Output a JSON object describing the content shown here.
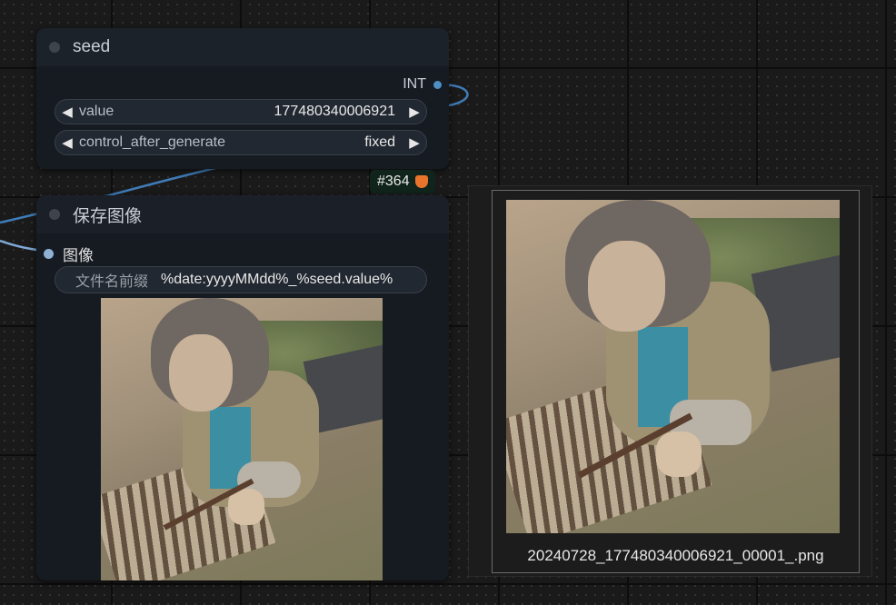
{
  "seed_node": {
    "title": "seed",
    "output_label": "INT",
    "widgets": [
      {
        "label": "value",
        "value": "177480340006921"
      },
      {
        "label": "control_after_generate",
        "value": "fixed"
      }
    ]
  },
  "badge": {
    "text": "#364"
  },
  "save_node": {
    "title": "保存图像",
    "input_label": "图像",
    "filename_label": "文件名前缀",
    "filename_value": "%date:yyyyMMdd%_%seed.value%"
  },
  "preview": {
    "filename": "20240728_177480340006921_00001_.png"
  },
  "colors": {
    "link": "#3f7cb8",
    "slot": "#4c90c6",
    "badge_bg": "#10241c",
    "node_bg": "#161b22"
  },
  "icons": [
    "arrow-left-icon",
    "arrow-right-icon",
    "fox-icon"
  ]
}
